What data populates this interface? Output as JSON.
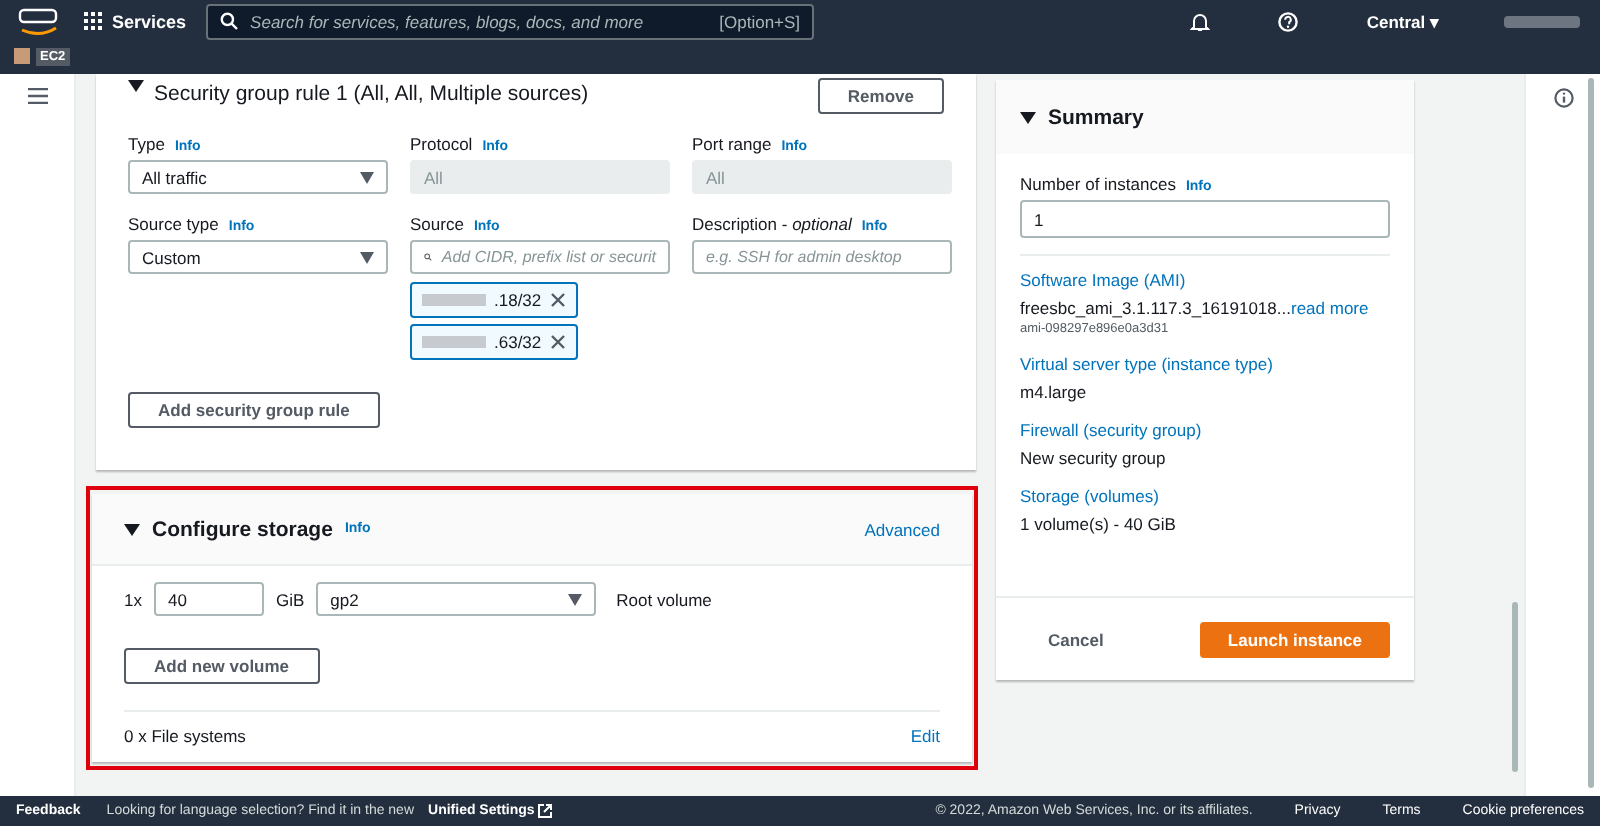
{
  "top_nav": {
    "services": "Services",
    "search_placeholder": "Search for services, features, blogs, docs, and more",
    "search_shortcut": "[Option+S]",
    "region": "Central ▾",
    "breadcrumb": "EC2"
  },
  "security_rule": {
    "title": "Security group rule 1 (All, All, Multiple sources)",
    "expanded": true,
    "remove": "Remove",
    "fields": [
      {
        "label": "Type",
        "info": "Info",
        "kind": "select",
        "value": "All traffic",
        "disabled": false
      },
      {
        "label": "Protocol",
        "info": "Info",
        "kind": "text",
        "value": "All",
        "disabled": true
      },
      {
        "label": "Port range",
        "info": "Info",
        "kind": "text",
        "value": "All",
        "disabled": true
      },
      {
        "label": "Source type",
        "info": "Info",
        "kind": "select",
        "value": "Custom",
        "disabled": false
      },
      {
        "label": "Source",
        "info": "Info",
        "kind": "search",
        "placeholder": "Add CIDR, prefix list or securit",
        "disabled": false
      },
      {
        "label": "Description - ",
        "label_note": "optional",
        "info": "Info",
        "kind": "text",
        "placeholder": "e.g. SSH for admin desktop",
        "disabled": false
      }
    ],
    "sources": [
      ".18/32",
      ".63/32"
    ],
    "add_button": "Add security group rule"
  },
  "storage": {
    "title": "Configure storage",
    "info": "Info",
    "advanced": "Advanced",
    "expanded": true,
    "volume": {
      "count": "1x",
      "size": "40",
      "unit": "GiB",
      "type": "gp2",
      "label": "Root volume"
    },
    "add_button": "Add new volume",
    "file_systems": "0 x File systems",
    "edit": "Edit"
  },
  "summary": {
    "title": "Summary",
    "expanded": true,
    "instances_label": "Number of instances",
    "info": "Info",
    "instances": "1",
    "items": [
      {
        "heading": "Software Image (AMI)",
        "value": "freesbc_ami_3.1.117.3_16191018...",
        "link": "read more",
        "sub": "ami-098297e896e0a3d31"
      },
      {
        "heading": "Virtual server type (instance type)",
        "value": "m4.large"
      },
      {
        "heading": "Firewall (security group)",
        "value": "New security group"
      },
      {
        "heading": "Storage (volumes)",
        "value": "1 volume(s) - 40 GiB"
      }
    ],
    "cancel": "Cancel",
    "launch": "Launch instance"
  },
  "footer": {
    "feedback": "Feedback",
    "language_note": "Looking for language selection? Find it in the new",
    "unified": "Unified Settings",
    "copyright": "© 2022, Amazon Web Services, Inc. or its affiliates.",
    "links": [
      "Privacy",
      "Terms",
      "Cookie preferences"
    ]
  }
}
